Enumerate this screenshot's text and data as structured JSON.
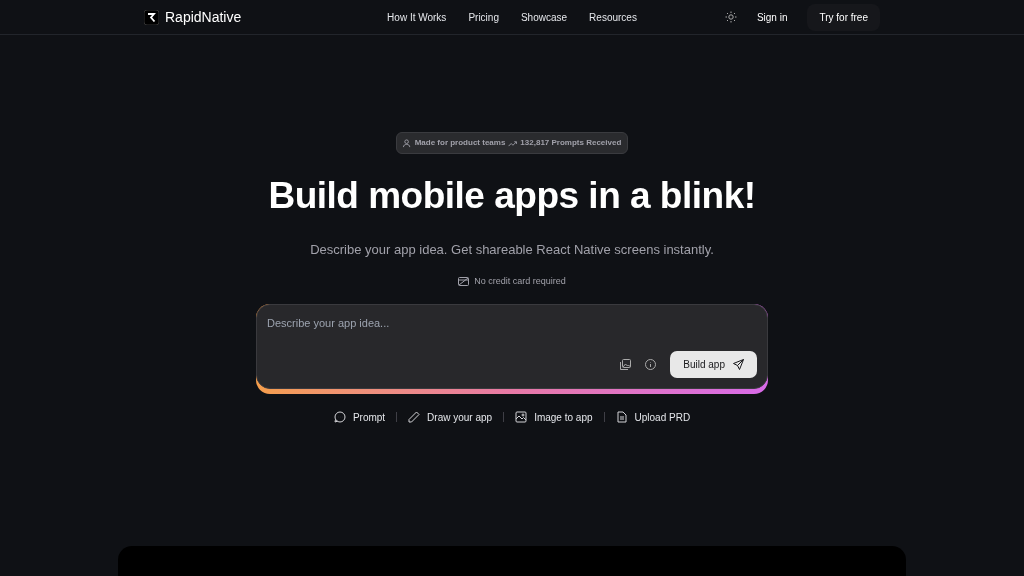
{
  "header": {
    "logo": "RapidNative",
    "nav": [
      "How It Works",
      "Pricing",
      "Showcase",
      "Resources"
    ],
    "sign_in": "Sign in",
    "cta": "Try for free"
  },
  "hero": {
    "badge_text": "Made for product teams",
    "badge_count": "132,817 Prompts Received",
    "title": "Build mobile apps in a blink!",
    "subtitle": "Describe your app idea. Get shareable React Native screens instantly.",
    "note": "No credit card required"
  },
  "prompt": {
    "placeholder": "Describe your app idea...",
    "submit": "Build app"
  },
  "modes": [
    {
      "kind": "chat",
      "label": "Prompt"
    },
    {
      "kind": "pencil",
      "label": "Draw your app"
    },
    {
      "kind": "image",
      "label": "Image to app"
    },
    {
      "kind": "file",
      "label": "Upload PRD"
    }
  ]
}
